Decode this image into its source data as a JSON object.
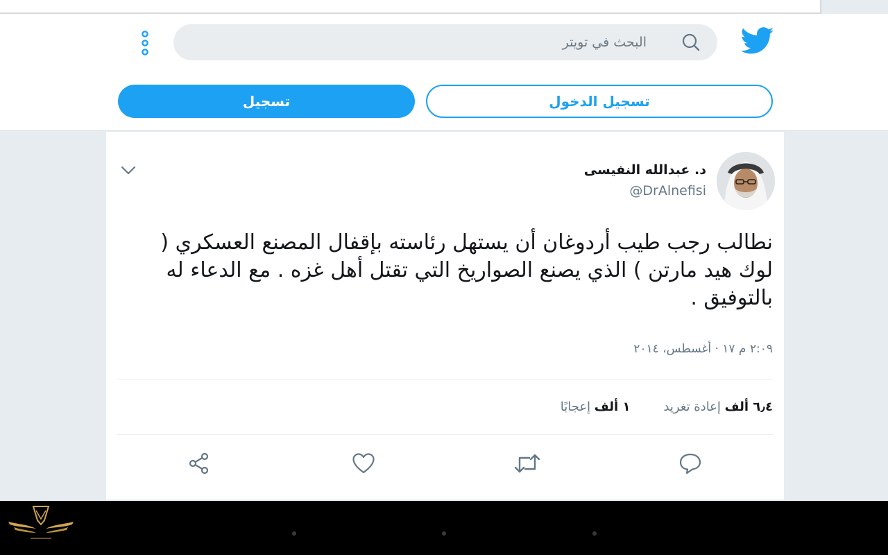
{
  "search": {
    "placeholder": "البحث في تويتر"
  },
  "auth": {
    "signup_label": "تسجيل",
    "login_label": "تسجيل الدخول"
  },
  "tweet": {
    "author_name": "د. عبدالله النفيسى",
    "author_handle": "@DrAlnefisi",
    "text": "نطالب رجب طيب أردوغان أن يستهل رئاسته بإقفال المصنع العسكري ( لوك هيد مارتن ) الذي يصنع الصواريخ التي تقتل أهل غزه . مع الدعاء له بالتوفيق .",
    "timestamp": "٢:٠٩ م ١٧ · أغسطس، ٢٠١٤",
    "retweets_count": "٦٫٤ ألف",
    "retweets_label": "إعادة تغريد",
    "likes_count": "١ ألف",
    "likes_label": "إعجابًا"
  },
  "icons": {
    "logo": "twitter-bird-icon",
    "search": "search-icon",
    "more": "more-vertical-icon",
    "caret": "chevron-down-icon",
    "reply": "reply-icon",
    "retweet": "retweet-icon",
    "like": "heart-icon",
    "share": "share-icon"
  },
  "colors": {
    "accent": "#1da1f2",
    "text": "#14171a",
    "muted": "#657786",
    "background": "#e6ecf0"
  }
}
